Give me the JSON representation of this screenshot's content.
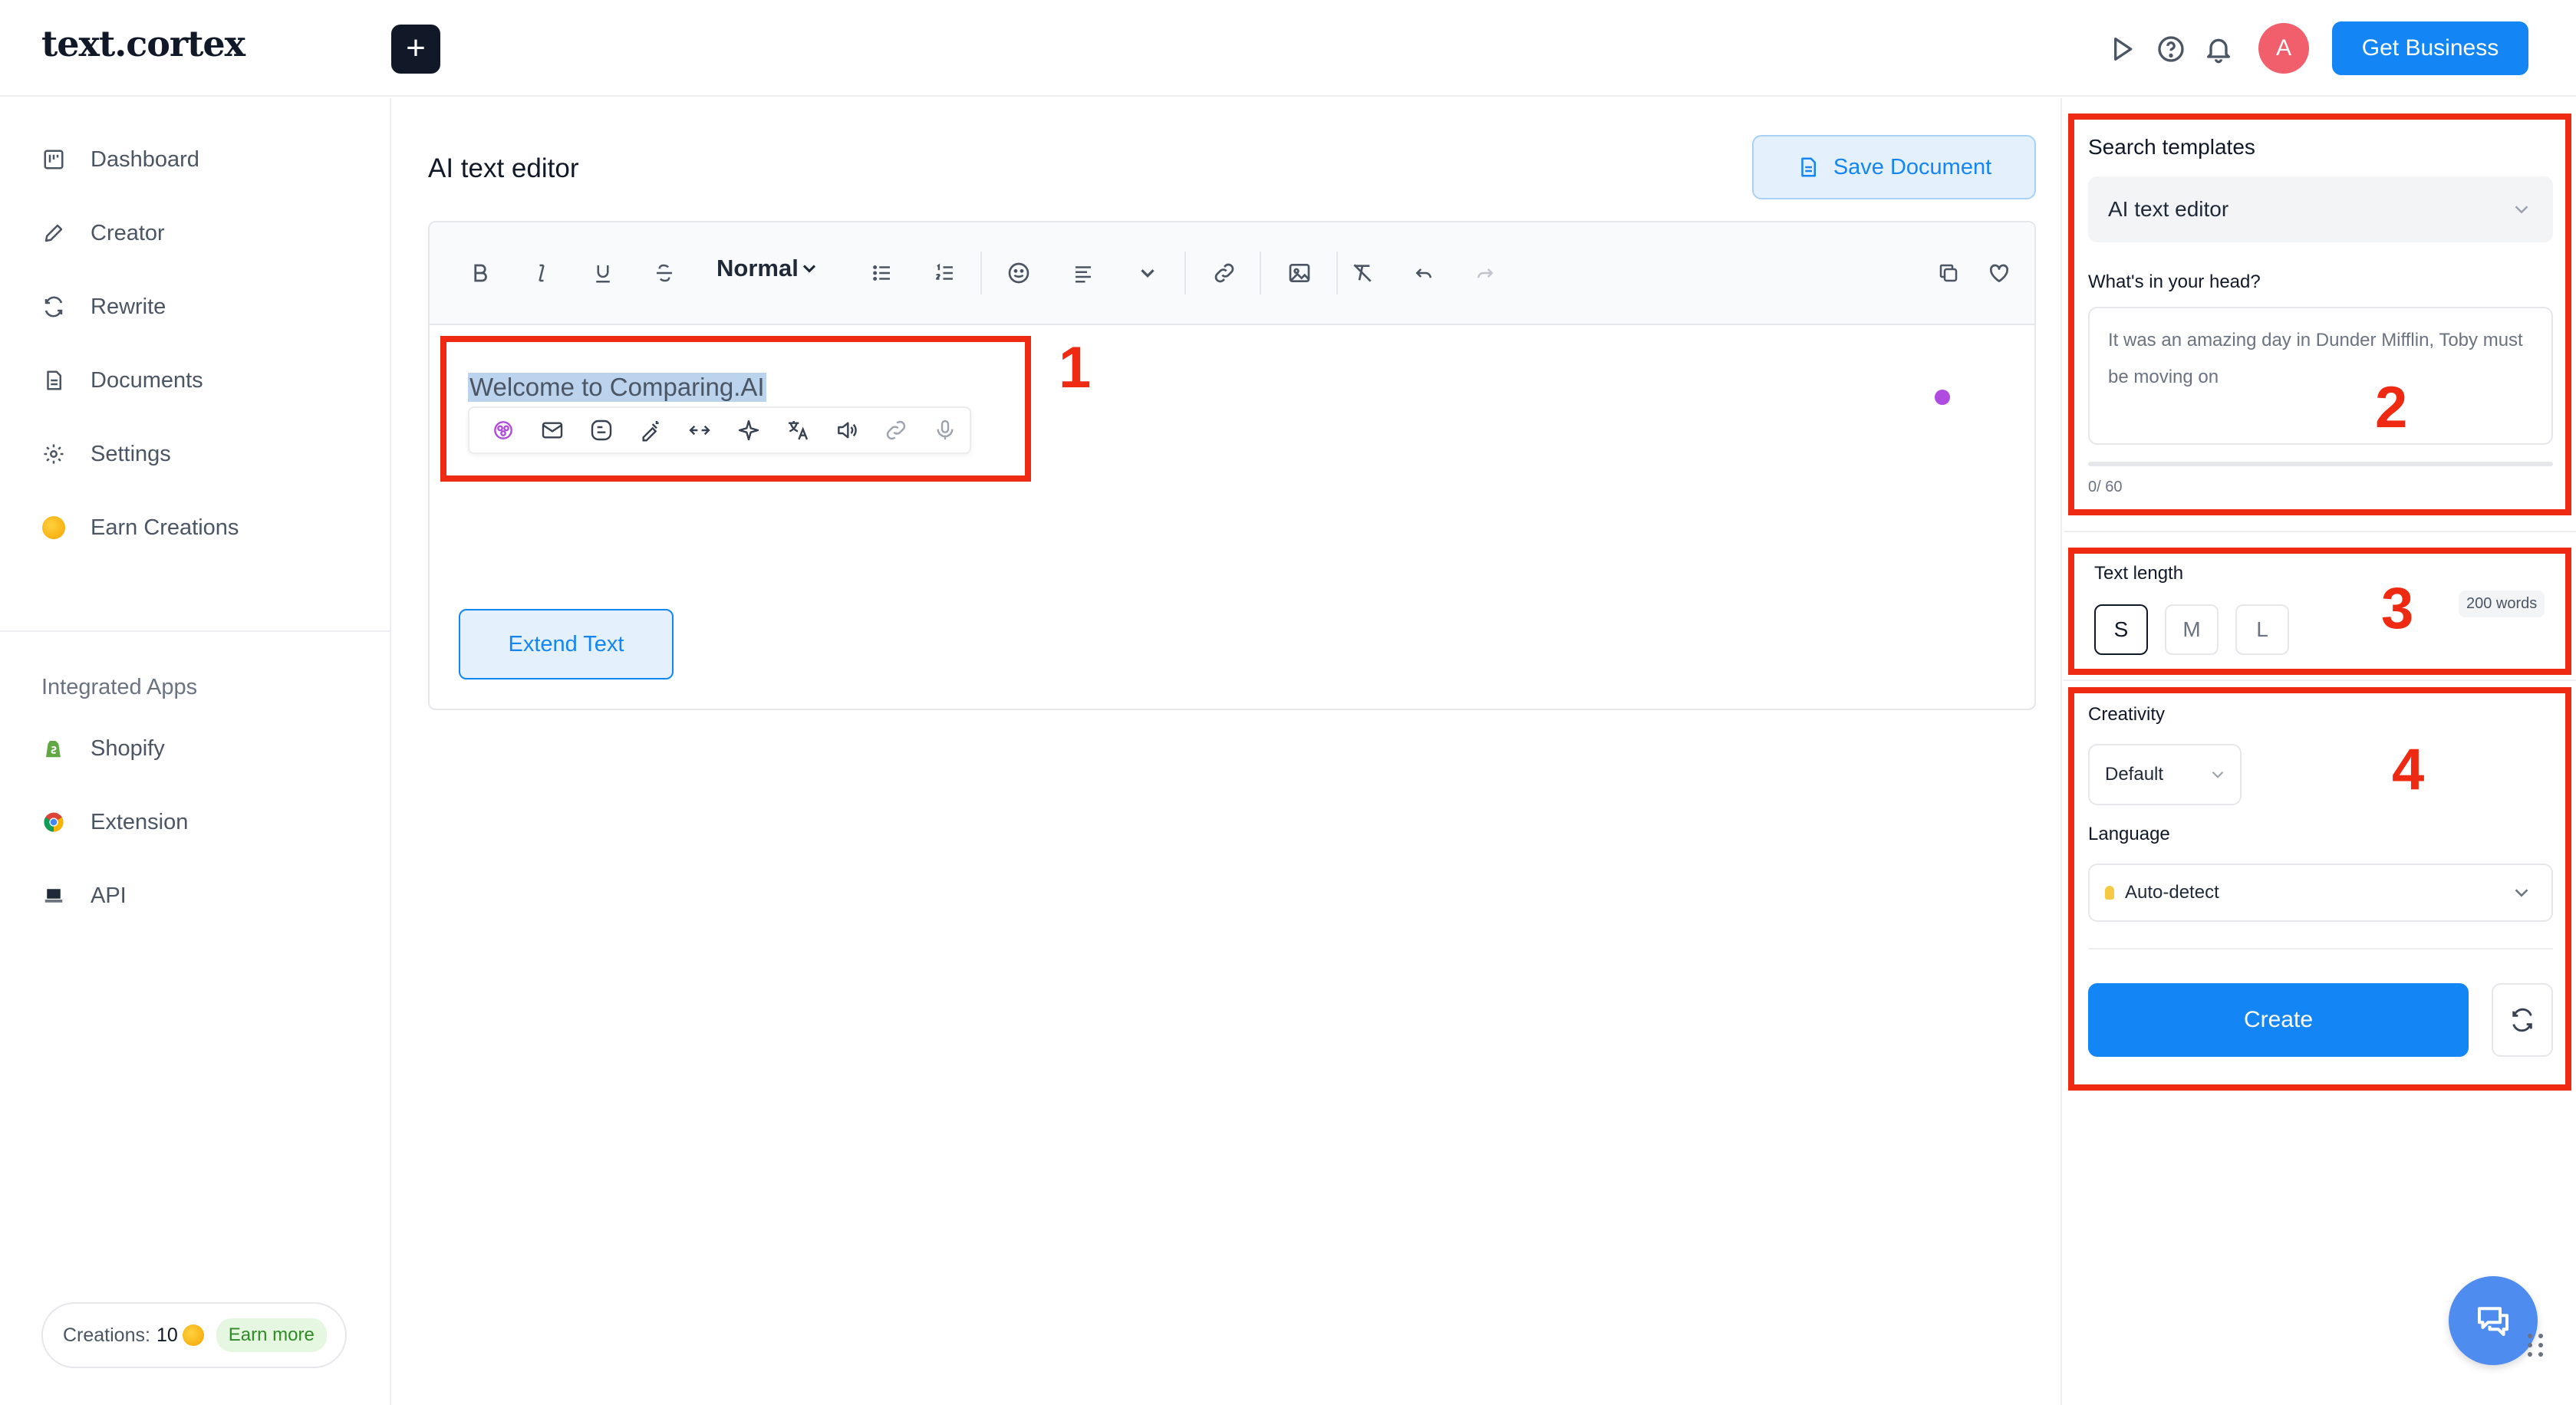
{
  "header": {
    "logo": "text.cortex",
    "new_button": "+",
    "avatar_initial": "A",
    "get_business": "Get Business"
  },
  "sidebar": {
    "items": [
      {
        "label": "Dashboard",
        "icon": "dashboard-icon"
      },
      {
        "label": "Creator",
        "icon": "pencil-icon"
      },
      {
        "label": "Rewrite",
        "icon": "rewrite-icon"
      },
      {
        "label": "Documents",
        "icon": "document-icon"
      },
      {
        "label": "Settings",
        "icon": "gear-icon"
      },
      {
        "label": "Earn Creations",
        "icon": "coin-icon"
      }
    ],
    "section_label": "Integrated Apps",
    "apps": [
      {
        "label": "Shopify",
        "icon": "shopify-icon"
      },
      {
        "label": "Extension",
        "icon": "chrome-icon"
      },
      {
        "label": "API",
        "icon": "laptop-icon"
      }
    ],
    "creations_label": "Creations:",
    "creations_count": "10",
    "earn_more": "Earn more"
  },
  "main": {
    "title": "AI text editor",
    "save_document": "Save Document",
    "toolbar": {
      "format_select": "Normal"
    },
    "editor_text": "Welcome to Comparing.AI",
    "extend_text": "Extend Text"
  },
  "panel": {
    "search_templates_label": "Search templates",
    "template_value": "AI text editor",
    "prompt_label": "What's in your head?",
    "prompt_placeholder": "It was an amazing day in Dunder Mifflin, Toby must be moving on",
    "char_counter": "0/ 60",
    "text_length_label": "Text length",
    "length_options": [
      "S",
      "M",
      "L"
    ],
    "length_selected": "S",
    "words_badge": "200 words",
    "creativity_label": "Creativity",
    "creativity_value": "Default",
    "language_label": "Language",
    "language_value": "Auto-detect",
    "create_button": "Create"
  },
  "annotations": [
    "1",
    "2",
    "3",
    "4"
  ],
  "colors": {
    "accent": "#1485f5",
    "annotation_red": "#ee2a12",
    "avatar": "#f05f6b",
    "dark": "#111827"
  }
}
